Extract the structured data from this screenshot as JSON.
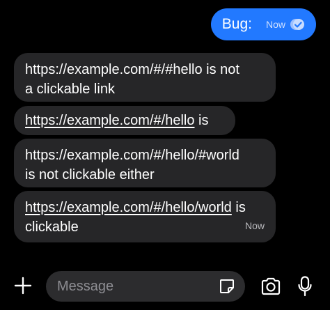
{
  "sent_message": {
    "text": "Bug:",
    "time": "Now",
    "status_icon": "read-check-icon"
  },
  "received_messages": [
    {
      "lines": [
        "https://example.com/#/#hello is not",
        "a clickable link"
      ]
    },
    {
      "link": "https://example.com/#/hello",
      "rest": " is"
    },
    {
      "lines": [
        "https://example.com/#/hello/#world",
        "is not clickable either"
      ]
    },
    {
      "link": "https://example.com/#/hello/world",
      "rest": " is",
      "line2": "clickable",
      "time": "Now"
    }
  ],
  "composer": {
    "placeholder": "Message",
    "icons": [
      "plus-icon",
      "sticker-icon",
      "camera-icon",
      "microphone-icon"
    ]
  },
  "colors": {
    "background": "#000000",
    "sent_bubble": "#2279ff",
    "received_bubble": "#262628",
    "input": "#2c2c2e"
  }
}
